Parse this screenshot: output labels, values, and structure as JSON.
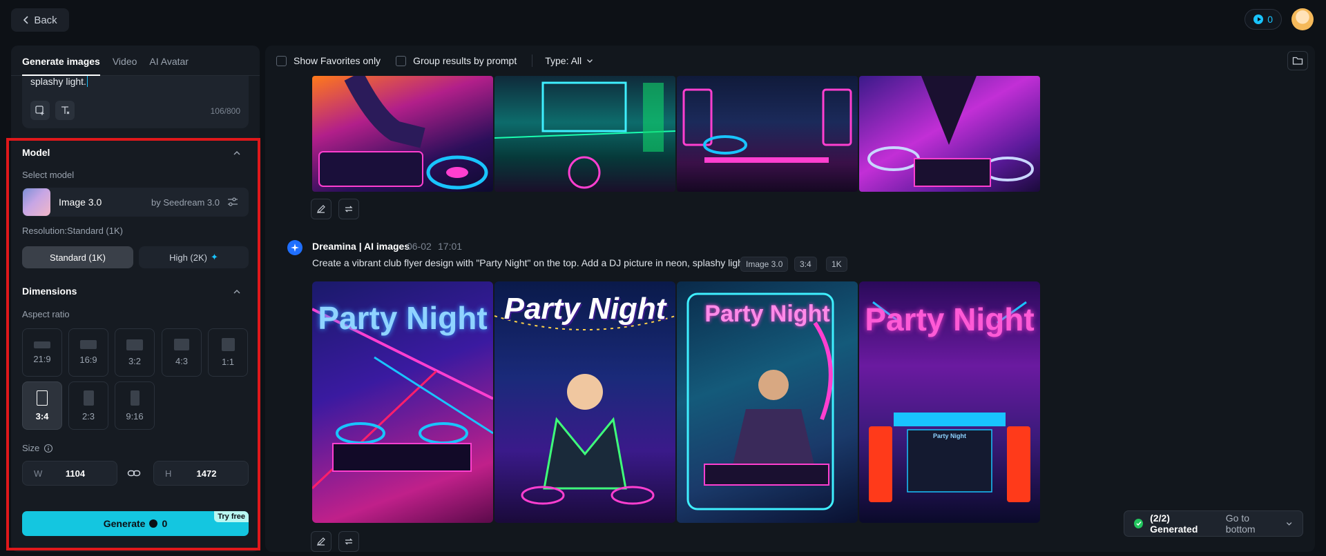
{
  "top_bar": {
    "back_label": "Back",
    "credits": "0"
  },
  "left_panel": {
    "tabs": [
      {
        "label": "Generate images",
        "active": true
      },
      {
        "label": "Video",
        "active": false
      },
      {
        "label": "AI Avatar",
        "active": false
      }
    ],
    "prompt": {
      "text": "splashy light.",
      "count": "106/800"
    },
    "model_section": {
      "title": "Model",
      "select_label": "Select model",
      "model_name": "Image 3.0",
      "model_by": "by Seedream 3.0",
      "resolution_label": "Resolution:Standard (1K)",
      "resolution_options": [
        {
          "label": "Standard (1K)",
          "selected": true
        },
        {
          "label": "High (2K)",
          "selected": false
        }
      ]
    },
    "dimensions_section": {
      "title": "Dimensions",
      "aspect_label": "Aspect ratio",
      "ratios": [
        {
          "label": "21:9",
          "selected": false
        },
        {
          "label": "16:9",
          "selected": false
        },
        {
          "label": "3:2",
          "selected": false
        },
        {
          "label": "4:3",
          "selected": false
        },
        {
          "label": "1:1",
          "selected": false
        },
        {
          "label": "3:4",
          "selected": true
        },
        {
          "label": "2:3",
          "selected": false
        },
        {
          "label": "9:16",
          "selected": false
        }
      ],
      "size_label": "Size",
      "width_prefix": "W",
      "width_value": "1104",
      "height_prefix": "H",
      "height_value": "1472"
    },
    "generate": {
      "label": "Generate",
      "cost": "0",
      "badge": "Try free"
    }
  },
  "right_panel": {
    "filters": {
      "favorites_label": "Show Favorites only",
      "group_label": "Group results by prompt",
      "type_label": "Type: All"
    },
    "result": {
      "author": "Dreamina | AI images",
      "date": "06-02",
      "time": "17:01",
      "prompt": "Create a vibrant club flyer design with \"Party Night\" on the top. Add a DJ picture in neon, splashy light.",
      "tags": [
        "Image 3.0",
        "3:4",
        "1K"
      ],
      "image_texts": {
        "img1": "Party Night",
        "img2": "Party Night",
        "img3": "Party Night",
        "img4": "Party Night",
        "img4_sign": "Party Night"
      }
    },
    "colors": {
      "accent": "#14c6e0",
      "highlight_border": "#e0181b"
    }
  },
  "toast": {
    "title": "(2/2) Generated",
    "link": "Go to bottom"
  }
}
